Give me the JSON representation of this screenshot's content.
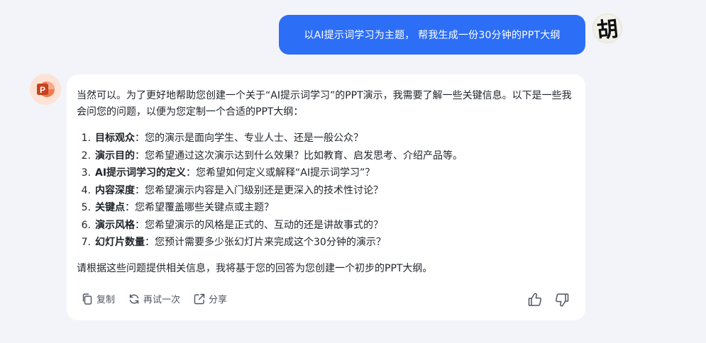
{
  "user_message": {
    "text": "以AI提示词学习为主题， 帮我生成一份30分钟的PPT大纲",
    "avatar_char": "胡"
  },
  "assistant": {
    "avatar_icon": "powerpoint-icon",
    "intro": "当然可以。为了更好地帮助您创建一个关于“AI提示词学习”的PPT演示，我需要了解一些关键信息。以下是一些我会问您的问题，以便为您定制一个合适的PPT大纲：",
    "questions": [
      {
        "num": "1.",
        "title": "目标观众",
        "text": "：您的演示是面向学生、专业人士、还是一般公众？"
      },
      {
        "num": "2.",
        "title": "演示目的",
        "text": "：您希望通过这次演示达到什么效果？比如教育、启发思考、介绍产品等。"
      },
      {
        "num": "3.",
        "title": "AI提示词学习的定义",
        "text": "：您希望如何定义或解释“AI提示词学习”？"
      },
      {
        "num": "4.",
        "title": "内容深度",
        "text": "：您希望演示内容是入门级别还是更深入的技术性讨论？"
      },
      {
        "num": "5.",
        "title": "关键点",
        "text": "：您希望覆盖哪些关键点或主题？"
      },
      {
        "num": "6.",
        "title": "演示风格",
        "text": "：您希望演示的风格是正式的、互动的还是讲故事式的？"
      },
      {
        "num": "7.",
        "title": "幻灯片数量",
        "text": "：您预计需要多少张幻灯片来完成这个30分钟的演示？"
      }
    ],
    "closing": "请根据这些问题提供相关信息，我将基于您的回答为您创建一个初步的PPT大纲。",
    "actions": {
      "copy": "复制",
      "retry": "再试一次",
      "share": "分享"
    }
  },
  "colors": {
    "page_bg": "#f2f4f9",
    "user_bubble": "#2d6ef6",
    "ppt_orange": "#e55a2b"
  }
}
